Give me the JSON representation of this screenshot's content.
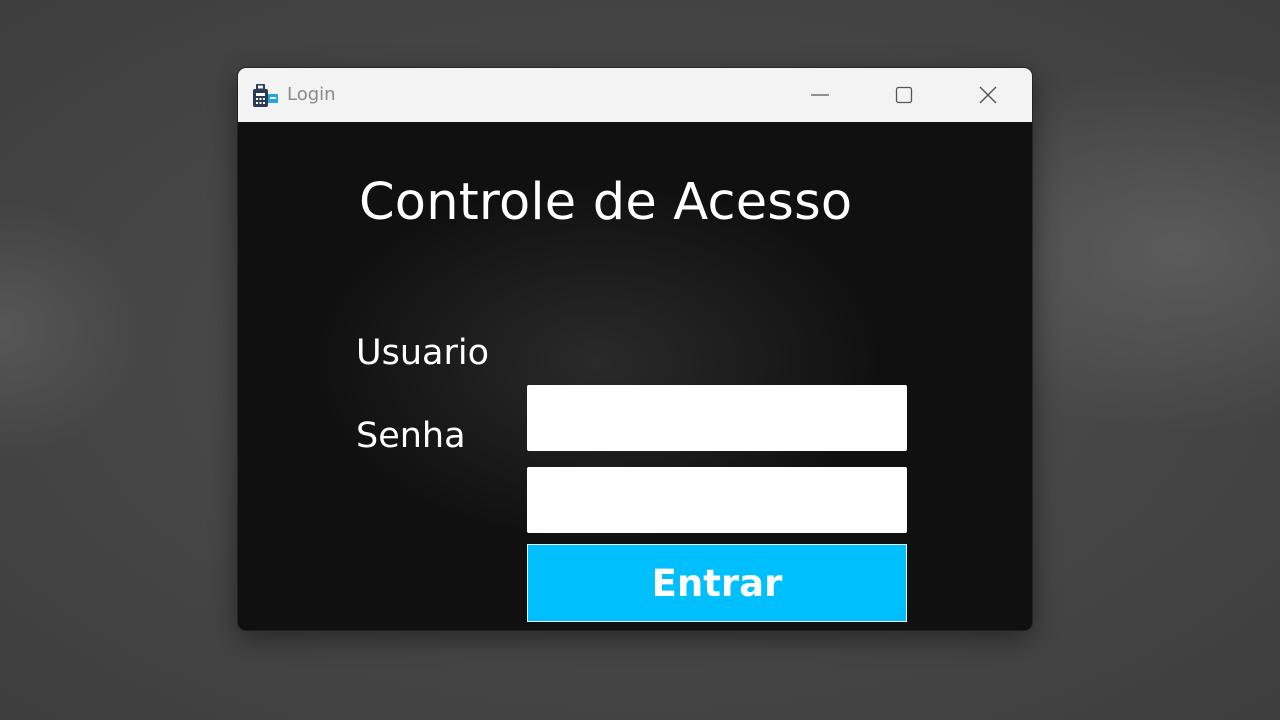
{
  "window": {
    "title": "Login",
    "icon": "login-app-icon",
    "controls": {
      "minimize_icon": "minimize-icon",
      "maximize_icon": "maximize-icon",
      "close_icon": "close-icon"
    }
  },
  "form": {
    "heading": "Controle de Acesso",
    "username_label": "Usuario",
    "username_value": "",
    "password_label": "Senha",
    "password_value": "",
    "submit_label": "Entrar"
  },
  "colors": {
    "titlebar": "#f3f3f3",
    "client_background": "#0d0d0d",
    "button_accent": "#00bfff",
    "text_light": "#ffffff"
  }
}
